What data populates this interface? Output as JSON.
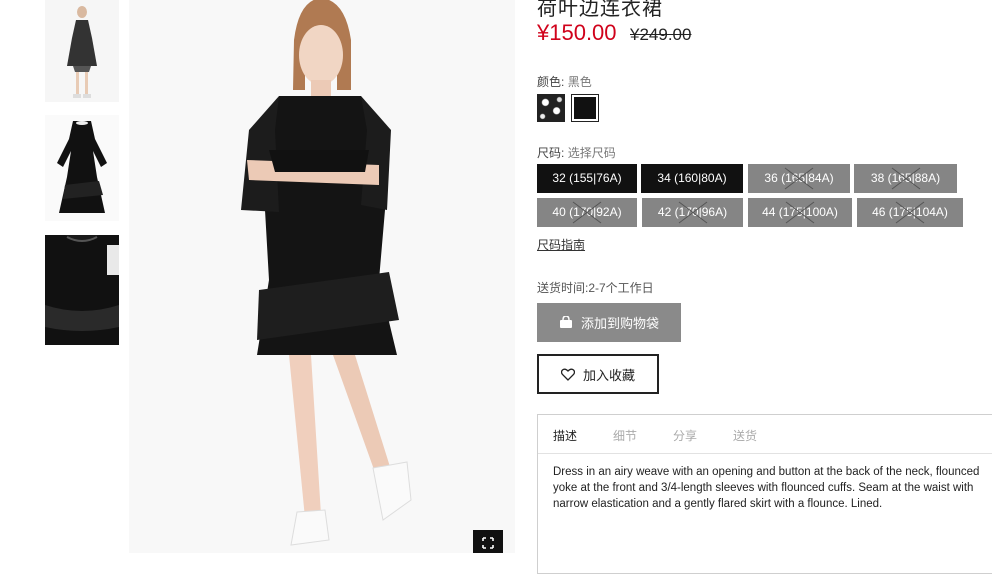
{
  "product": {
    "title": "荷叶边连衣裙",
    "price": "¥150.00",
    "old_price": "¥249.00"
  },
  "color": {
    "label": "颜色:",
    "selected": "黑色",
    "swatches": [
      "floral",
      "black"
    ]
  },
  "size": {
    "label": "尺码:",
    "placeholder": "选择尺码",
    "options": [
      {
        "label": "32 (155|76A)",
        "available": true
      },
      {
        "label": "34 (160|80A)",
        "available": true
      },
      {
        "label": "36 (165|84A)",
        "available": false
      },
      {
        "label": "38 (165|88A)",
        "available": false
      },
      {
        "label": "40 (170|92A)",
        "available": false
      },
      {
        "label": "42 (170|96A)",
        "available": false
      },
      {
        "label": "44 (175|100A)",
        "available": false
      },
      {
        "label": "46 (175|104A)",
        "available": false
      }
    ],
    "guide": "尺码指南"
  },
  "delivery": "送货时间:2-7个工作日",
  "buttons": {
    "add_to_bag": "添加到购物袋",
    "favorite": "加入收藏"
  },
  "tabs": [
    {
      "label": "描述",
      "active": true
    },
    {
      "label": "细节",
      "active": false
    },
    {
      "label": "分享",
      "active": false
    },
    {
      "label": "送货",
      "active": false
    }
  ],
  "description": "Dress in an airy weave with an opening and button at the back of the neck, flounced yoke at the front and 3/4-length sleeves with flounced cuffs. Seam at the waist with narrow elastication and a gently flared skirt with a flounce. Lined.",
  "colors": {
    "price_red": "#d0021b",
    "size_available": "#111111",
    "size_unavailable": "#858585",
    "add_bag_bg": "#8a8a8a"
  }
}
